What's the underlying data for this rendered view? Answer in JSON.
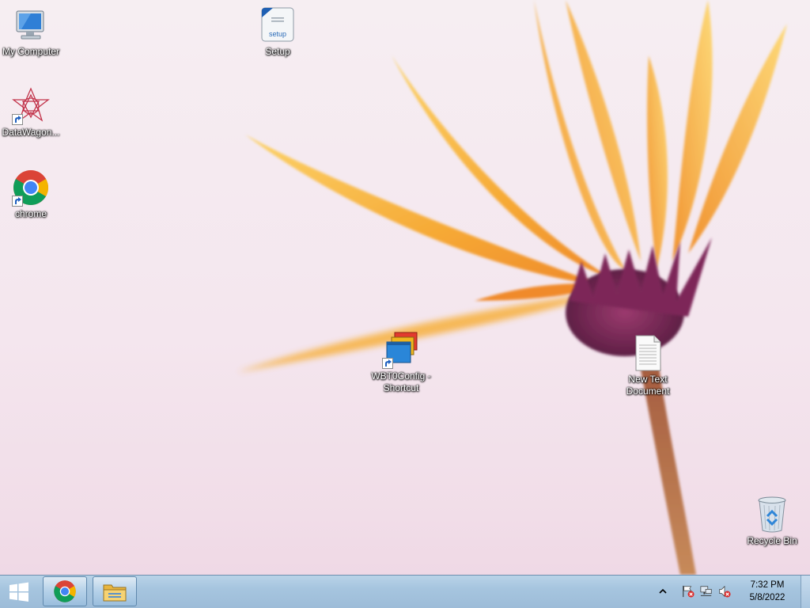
{
  "desktop": {
    "icons": [
      {
        "name": "My Computer"
      },
      {
        "name": "DataWagon..."
      },
      {
        "name": "chrome"
      },
      {
        "name": "Setup"
      },
      {
        "name": "WBT0Config -\nShortcut",
        "line1": "WBT0Config -",
        "line2": "Shortcut"
      },
      {
        "name": "New Text Document",
        "line1": "New Text",
        "line2": "Document"
      },
      {
        "name": "Recycle Bin"
      }
    ]
  },
  "taskbar": {
    "pinned": [
      {
        "icon": "chrome-icon"
      },
      {
        "icon": "file-explorer-icon"
      }
    ],
    "tray": {
      "icons": [
        "show-hidden-icons-arrow",
        "action-center-flag-icon",
        "network-icon",
        "volume-muted-icon"
      ]
    },
    "clock": {
      "time": "7:32 PM",
      "date": "5/8/2022"
    }
  },
  "colors": {
    "taskbar": "#a6c5df",
    "wallpaper_bg": "#f4e6ee",
    "petal": "#f6b03a",
    "flower_center": "#7a2a5a"
  }
}
